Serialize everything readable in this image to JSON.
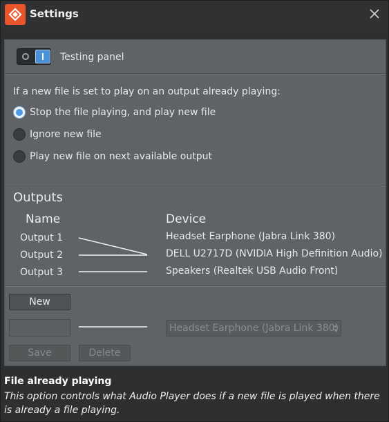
{
  "window": {
    "title": "Settings",
    "icon": "app-logo-icon",
    "close_icon": "close-icon",
    "accent_color": "#e8562b"
  },
  "testing_panel": {
    "label": "Testing panel",
    "enabled": true
  },
  "playback": {
    "question": "If a new file is set to play on an output already playing:",
    "options": [
      {
        "label": "Stop the file playing, and play new file",
        "selected": true
      },
      {
        "label": "Ignore new file",
        "selected": false
      },
      {
        "label": "Play new file on next available output",
        "selected": false
      }
    ]
  },
  "outputs": {
    "title": "Outputs",
    "name_header": "Name",
    "device_header": "Device",
    "names": [
      "Output 1",
      "Output 2",
      "Output 3"
    ],
    "devices": [
      "Headset Earphone (Jabra Link 380)",
      "DELL U2717D (NVIDIA High Definition Audio)",
      "Speakers (Realtek USB Audio Front)"
    ],
    "links": [
      {
        "output": "Output 1",
        "device": "DELL U2717D (NVIDIA High Definition Audio)"
      },
      {
        "output": "Output 2",
        "device": "DELL U2717D (NVIDIA High Definition Audio)"
      },
      {
        "output": "Output 3",
        "device": "Speakers (Realtek USB Audio Front)"
      }
    ]
  },
  "editor": {
    "new_label": "New",
    "name_value": "",
    "selected_device": "Headset Earphone (Jabra Link 380)",
    "save_label": "Save",
    "delete_label": "Delete"
  },
  "help": {
    "title": "File already playing",
    "text": "This option controls what Audio Player does if a new file is played when there is already a file playing."
  }
}
